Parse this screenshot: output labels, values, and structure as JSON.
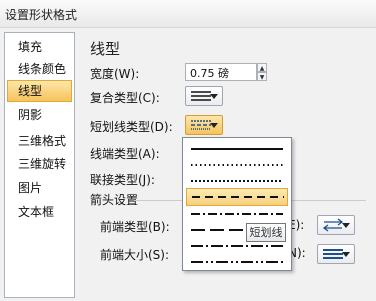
{
  "window": {
    "title": "设置形状格式"
  },
  "sidebar": {
    "items": [
      {
        "label": "填充",
        "active": false
      },
      {
        "label": "线条颜色",
        "active": false
      },
      {
        "label": "线型",
        "active": true
      },
      {
        "label": "阴影",
        "active": false
      },
      {
        "label": "三维格式",
        "active": false
      },
      {
        "label": "三维旋转",
        "active": false
      },
      {
        "label": "图片",
        "active": false
      },
      {
        "label": "文本框",
        "active": false
      }
    ]
  },
  "main": {
    "section_title": "线型",
    "width_label": "宽度(W):",
    "width_value": "0.75 磅",
    "compound_label": "复合类型(C):",
    "dash_label": "短划线类型(D):",
    "cap_label": "线端类型(A):",
    "join_label": "联接类型(J):",
    "arrow_group_label": "箭头设置",
    "begin_type_label": "前端类型(B):",
    "begin_size_label": "前端大小(S):",
    "end_type_label_partial": "E):",
    "end_size_label_partial": "N):"
  },
  "dash_popup": {
    "options": [
      "solid",
      "round-dot",
      "square-dot",
      "dash",
      "dash-dot",
      "long-dash",
      "long-dash-dot",
      "long-dash-dot-dot"
    ],
    "selected_index": 3,
    "tooltip": "短划线"
  },
  "colors": {
    "accent_highlight": "#f6c35d",
    "accent_border": "#e3a83a"
  }
}
